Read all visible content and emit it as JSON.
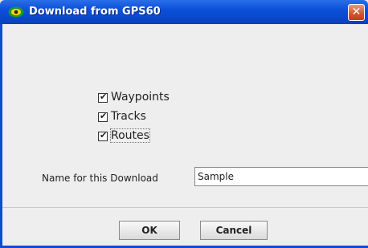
{
  "window": {
    "title": "Download from GPS60",
    "app_icon": "eye-icon",
    "close_icon": "close-icon",
    "close_glyph": "✕"
  },
  "checkboxes": [
    {
      "label": "Waypoints",
      "checked": true
    },
    {
      "label": "Tracks",
      "checked": true
    },
    {
      "label": "Routes",
      "checked": true
    }
  ],
  "name_field": {
    "label": "Name for this Download",
    "value": "Sample"
  },
  "buttons": {
    "ok": "OK",
    "cancel": "Cancel"
  }
}
